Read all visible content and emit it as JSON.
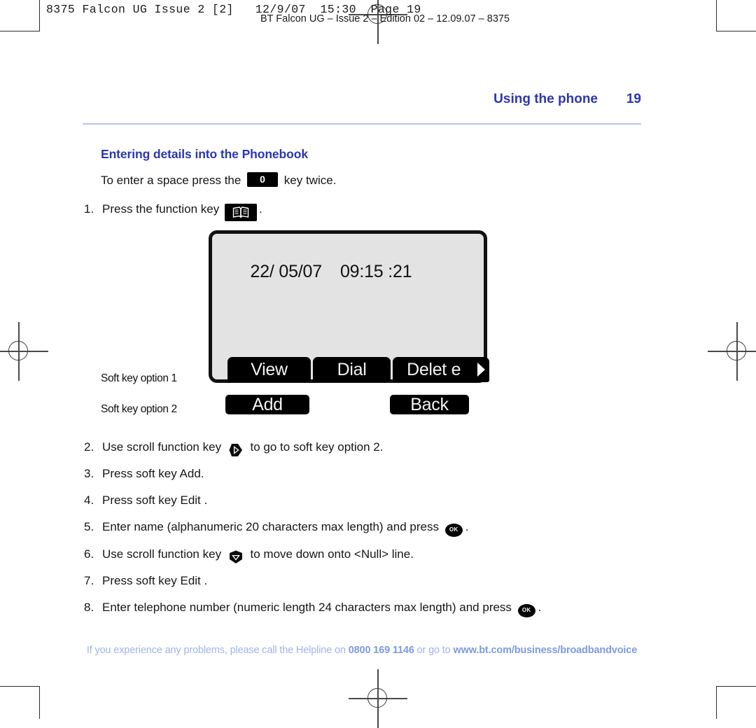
{
  "prepress": {
    "slug_main": "8375 Falcon UG Issue 2 [2]   12/9/07  15:30  Page 19",
    "slug_sub": "BT Falcon UG – Issue 2 – Edition 02 – 12.09.07 – 8375"
  },
  "running_head": {
    "title": "Using the phone",
    "folio": "19"
  },
  "section": {
    "title": "Entering details into the Phonebook",
    "intro_before": "To enter a space press the ",
    "intro_key": "0",
    "intro_after": " key twice."
  },
  "steps": [
    {
      "num": "1.",
      "before": "Press the function key ",
      "icon": "phonebook-book-icon",
      "after": "."
    },
    {
      "num": "2.",
      "before": "Use scroll function key ",
      "icon": "scroll-right-icon",
      "after": " to go to soft key option 2."
    },
    {
      "num": "3.",
      "before": "Press soft key Add.",
      "icon": "",
      "after": ""
    },
    {
      "num": "4.",
      "before": "Press soft key Edit .",
      "icon": "",
      "after": ""
    },
    {
      "num": "5.",
      "before": "Enter name (alphanumeric 20 characters max length) and press ",
      "icon": "ok-key-icon",
      "after": "."
    },
    {
      "num": "6.",
      "before": "Use scroll function key ",
      "icon": "scroll-down-icon",
      "after": " to move down onto <Null> line."
    },
    {
      "num": "7.",
      "before": "Press soft key Edit .",
      "icon": "",
      "after": ""
    },
    {
      "num": "8.",
      "before": "Enter telephone number (numeric length 24 characters max length) and press ",
      "icon": "ok-key-icon",
      "after": "."
    }
  ],
  "lcd": {
    "date": "22/ 05/07",
    "time": "09:15 :21",
    "softkeys_row1": [
      "View",
      "Dial",
      "Delet e"
    ],
    "more_arrow": "right-arrow-icon",
    "softkeys_row2": [
      "Add",
      "Back"
    ]
  },
  "callouts": {
    "soft_key_option_1": "Soft key option 1",
    "soft_key_option_2": "Soft key option 2"
  },
  "footer": {
    "text_1": "If you experience any problems, please call the Helpline on ",
    "phone": "0800 169 1146",
    "text_2": " or go to ",
    "url": "www.bt.com/business/broadbandvoice"
  },
  "colors": {
    "heading_blue": "#2c36b4",
    "rule_blue": "#b9c4ea",
    "footer_blue": "#9fb4e6",
    "lcd_background": "#e3e3e3",
    "key_black": "#000000"
  }
}
